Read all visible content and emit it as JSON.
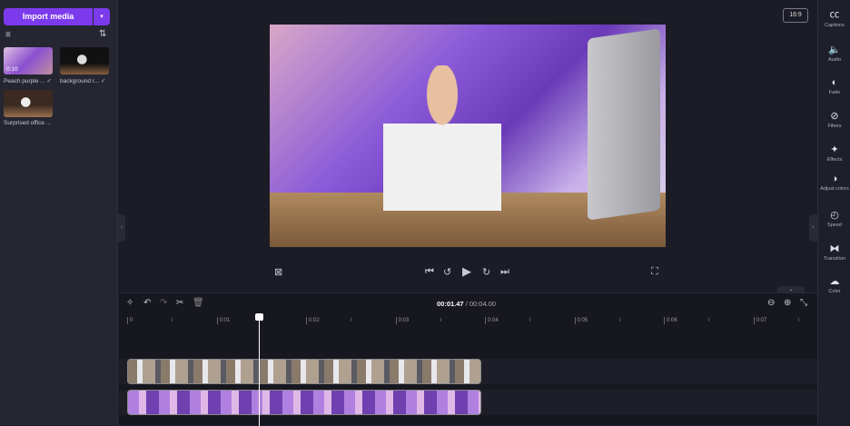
{
  "media_panel": {
    "import_label": "Import media",
    "items": [
      {
        "caption": "Peach purple ...",
        "duration": "0:10",
        "checked": true
      },
      {
        "caption": "background r...",
        "checked": true
      },
      {
        "caption": "Surprised office ..."
      }
    ]
  },
  "preview": {
    "aspect_ratio": "16:9"
  },
  "timeline": {
    "current_time": "00:01.47",
    "total_time": "/ 00:04.00",
    "ruler_labels": [
      "0",
      "0:01",
      "0:02",
      "0:03",
      "0:04",
      "0:05",
      "0:06",
      "0:07"
    ],
    "playhead_seconds": 1.47
  },
  "right_toolbar": [
    {
      "label": "Captions",
      "icon": "captions-icon",
      "glyph": "㏄"
    },
    {
      "label": "Audio",
      "icon": "audio-icon",
      "glyph": "🔈"
    },
    {
      "label": "Fade",
      "icon": "fade-icon",
      "glyph": "◐"
    },
    {
      "label": "Filters",
      "icon": "filters-icon",
      "glyph": "⊘"
    },
    {
      "label": "Effects",
      "icon": "effects-icon",
      "glyph": "✦"
    },
    {
      "label": "Adjust colors",
      "icon": "adjust-colors-icon",
      "glyph": "◑"
    },
    {
      "label": "Speed",
      "icon": "speed-icon",
      "glyph": "◴"
    },
    {
      "label": "Transition",
      "icon": "transition-icon",
      "glyph": "⧓"
    },
    {
      "label": "Color",
      "icon": "palette-icon",
      "glyph": "☁"
    }
  ],
  "colors": {
    "accent": "#7c3aed",
    "background": "#1c1c26",
    "panel": "#262632"
  }
}
